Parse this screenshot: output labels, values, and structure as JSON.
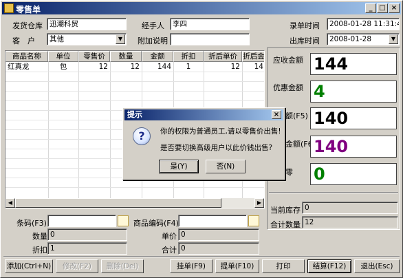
{
  "window": {
    "title": "零售单"
  },
  "header": {
    "warehouse_label": "发货仓库",
    "warehouse_value": "迅潮科贸",
    "handler_label": "经手人",
    "handler_value": "李四",
    "entry_time_label": "录单时间",
    "entry_time_value": "2008-01-28 11:31:49",
    "customer_label": "客　户",
    "customer_value": "其他",
    "note_label": "附加说明",
    "note_value": "",
    "out_time_label": "出库时间",
    "out_time_value": "2008-01-28"
  },
  "grid": {
    "columns": [
      "商品名称",
      "单位",
      "零售价",
      "数量",
      "金额",
      "折扣",
      "折后单价",
      "折后金"
    ],
    "rows": [
      [
        "红真龙",
        "包",
        "12",
        "12",
        "144",
        "1",
        "12",
        "14"
      ]
    ]
  },
  "summary": {
    "receivable_label": "应收金额",
    "receivable_value": "144",
    "discount_label": "优惠金额",
    "discount_value": "4",
    "f5_label": "额(F5)",
    "f5_value": "140",
    "f6_label": "金额(F6)",
    "f6_value": "140",
    "change_label": "零",
    "change_value": "0",
    "stock_label": "当前库存",
    "stock_value": "0",
    "total_qty_label": "合计数量",
    "total_qty_value": "12"
  },
  "lower": {
    "barcode_label": "条码(F3)",
    "barcode_value": "",
    "product_code_label": "商品编码(F4)",
    "product_code_value": "",
    "qty_label": "数量",
    "qty_value": "0",
    "price_label": "单价",
    "price_value": "0",
    "discount_label": "折扣",
    "discount_value": "1",
    "total_label": "合计",
    "total_value": "0"
  },
  "buttons": {
    "add": "添加(Ctrl+N)",
    "modify": "修改(F2)",
    "delete": "删除(Del)",
    "hold": "挂单(F9)",
    "retrieve": "提单(F10)",
    "print": "打印",
    "checkout": "结算(F12)",
    "exit": "退出(Esc)"
  },
  "dialog": {
    "title": "提示",
    "line1": "你的权限为普通员工,请以零售价出售!",
    "line2": "是否要切换高级用户以此价钱出售?",
    "yes": "是(Y)",
    "no": "否(N)"
  },
  "colors": {
    "discount": "#008000",
    "f6": "#800080",
    "change": "#008000"
  }
}
